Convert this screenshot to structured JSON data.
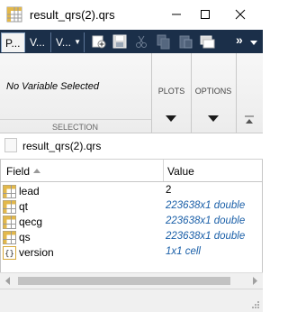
{
  "window": {
    "title": "result_qrs(2).qrs"
  },
  "toolstrip": {
    "tabs": [
      {
        "label": "P..."
      },
      {
        "label": "V..."
      },
      {
        "label": "V..."
      }
    ],
    "overflow": "»"
  },
  "ribbon": {
    "selection_text": "No Variable Selected",
    "selection_section": "SELECTION",
    "plots_label": "PLOTS",
    "options_label": "OPTIONS"
  },
  "file": {
    "name": "result_qrs(2).qrs"
  },
  "table": {
    "headers": {
      "field": "Field",
      "value": "Value"
    },
    "rows": [
      {
        "field": "lead",
        "value": "2",
        "icon": "array-icon",
        "is_link": false
      },
      {
        "field": "qt",
        "value": "223638x1 double",
        "icon": "array-icon",
        "is_link": true
      },
      {
        "field": "qecg",
        "value": "223638x1 double",
        "icon": "array-icon",
        "is_link": true
      },
      {
        "field": "qs",
        "value": "223638x1 double",
        "icon": "array-icon",
        "is_link": true
      },
      {
        "field": "version",
        "value": "1x1 cell",
        "icon": "cell-icon",
        "is_link": true
      }
    ]
  },
  "colors": {
    "toolstrip_bg": "#1b2f49",
    "link_text": "#1a5fa8",
    "array_icon": "#e3b84a",
    "cell_icon": "#d7a93b"
  }
}
